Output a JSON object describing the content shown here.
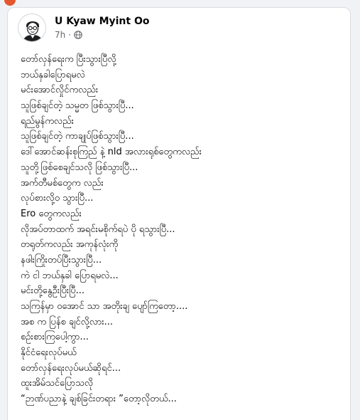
{
  "post": {
    "author": "U Kyaw Myint Oo",
    "time": "7h",
    "separator": "·",
    "privacy_icon": "globe-icon",
    "lines": [
      "တော်လှန်ရေးက ပြီးသွားပြီလို့",
      "ဘယ်နှခါပြောရမလဲ",
      "မင်းအောင်လှိုင်ကလည်း",
      "သူဖြစ်ချင်တဲ့ သမ္မတ ဖြစ်သွားပြီ...",
      "ရည်မွန်ကလည်း",
      "သူဖြစ်ချင်တဲ့ ကာချုပ်ဖြစ်သွားပြီ...",
      "ဒေါ်အောင်ဆန်းစုကြည် နဲ့ nld အလားရုစ်တွေကလည်း",
      "သူတို့ဖြစ်စေချင်သလို ဖြစ်သွားပြီ...",
      "အက်တီမစ်တွေက လည်း",
      "လုပ်စားလို့ဝ သွားပြီ...",
      "Ero တွေကလည်း",
      "လိုအပ်တာထက် အရင်းမစိုက်ရပဲ ပို ရသွားပြီ...",
      "တရုတ်ကလည်း အကုန်လုံးကို",
      "နဖါးကြိုးတပ်ပြီးသွားပြီ...",
      "ကဲ ငါ ဘယ်နှခါ ပြောရမလဲ...",
      "မင်းတို့နွေဦးပြီးပြီ...",
      "သကြန်မှာ ဝအောင် သာ အတိုးချ ပျော်ကြတော့....",
      "အစ က ပြန်စ ချင်လို့လား...",
      "စဉ်းစားကြပေါ့ကွာ...",
      "နိုင်ငံရေးလုပ်မယ်",
      "တော်လှန်ရေးလုပ်မယ်ဆိုရင်...",
      "ထူးအိမ်သင်ပြောသလို",
      "“ဉာဏ်ပညာနဲ့ ချစ်ခြင်းတရား ”တော့လိုတယ်..."
    ]
  },
  "colors": {
    "background": "#f0f2f5",
    "card": "#ffffff",
    "text": "#050505",
    "meta_text": "#65676b"
  }
}
